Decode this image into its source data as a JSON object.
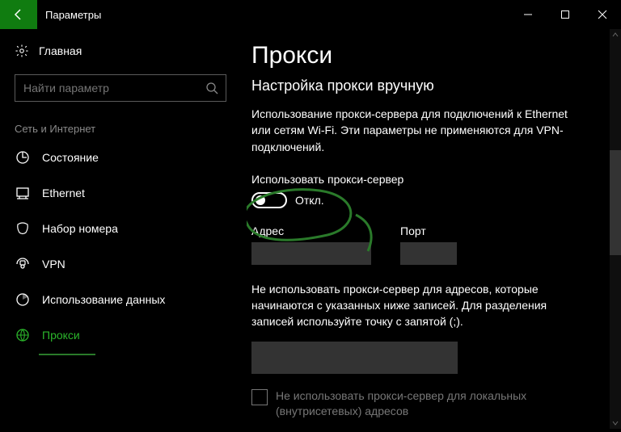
{
  "window": {
    "title": "Параметры"
  },
  "sidebar": {
    "home": "Главная",
    "searchPlaceholder": "Найти параметр",
    "category": "Сеть и Интернет",
    "items": [
      {
        "label": "Состояние"
      },
      {
        "label": "Ethernet"
      },
      {
        "label": "Набор номера"
      },
      {
        "label": "VPN"
      },
      {
        "label": "Использование данных"
      },
      {
        "label": "Прокси"
      }
    ]
  },
  "main": {
    "title": "Прокси",
    "section": "Настройка прокси вручную",
    "description": "Использование прокси-сервера для подключений к Ethernet или сетям Wi-Fi. Эти параметры не применяются для VPN-подключений.",
    "useProxyLabel": "Использовать прокси-сервер",
    "toggleState": "Откл.",
    "addressLabel": "Адрес",
    "portLabel": "Порт",
    "exclusionText": "Не использовать прокси-сервер для адресов, которые начинаются с указанных ниже записей. Для разделения записей используйте точку с запятой (;).",
    "localCheckbox": "Не использовать прокси-сервер для локальных (внутрисетевых) адресов"
  }
}
